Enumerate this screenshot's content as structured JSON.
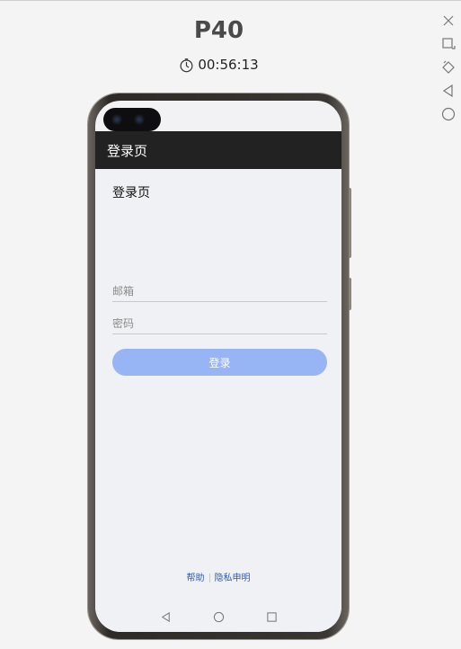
{
  "device": {
    "name": "P40",
    "timer": "00:56:13"
  },
  "side_tools": [
    "close-icon",
    "window-dock-icon",
    "rotate-icon",
    "back-icon",
    "home-icon"
  ],
  "app": {
    "appbar_title": "登录页",
    "page_heading": "登录页",
    "email_placeholder": "邮箱",
    "password_placeholder": "密码",
    "login_label": "登录",
    "help_link": "帮助",
    "privacy_link": "隐私申明"
  },
  "colors": {
    "appbar": "#222222",
    "login_button": "#97b5f5",
    "link": "#2d5bc4",
    "background": "#f0f1f5"
  }
}
